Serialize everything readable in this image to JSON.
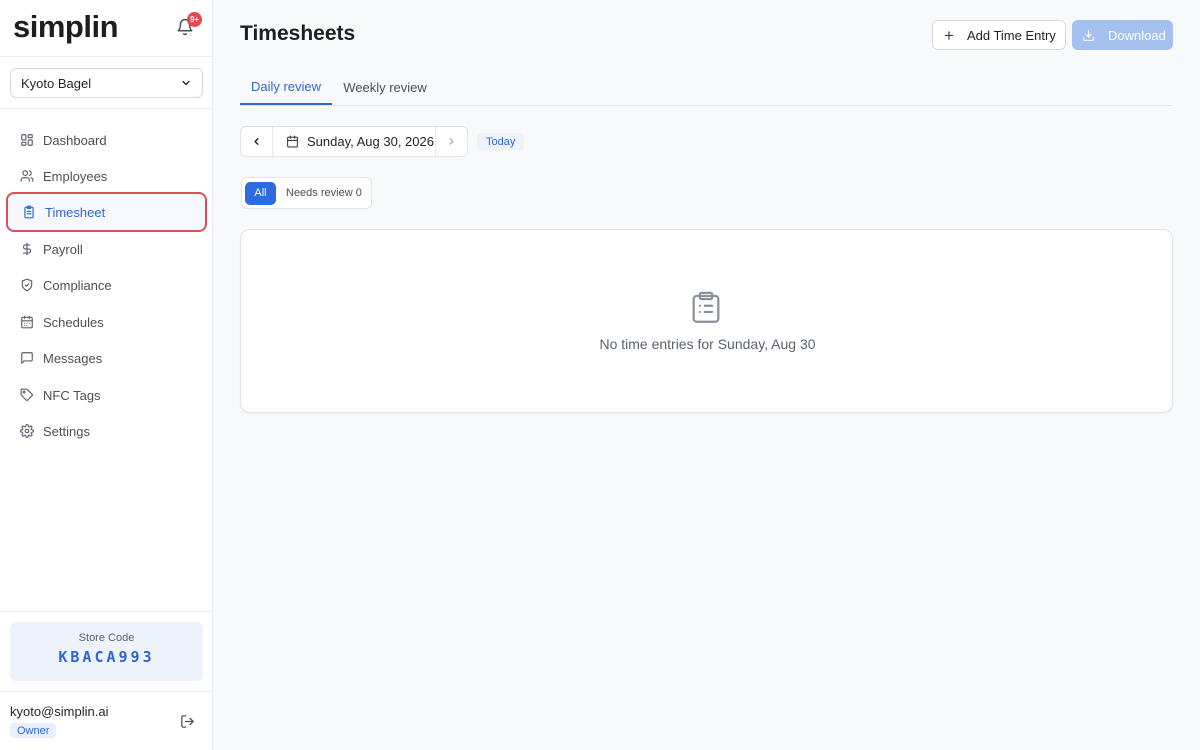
{
  "brand": {
    "name": "simplin",
    "notification_count": "9+"
  },
  "store_selector": {
    "value": "Kyoto Bagel"
  },
  "sidebar": {
    "items": [
      {
        "label": "Dashboard",
        "icon": "dashboard-icon"
      },
      {
        "label": "Employees",
        "icon": "users-icon"
      },
      {
        "label": "Timesheet",
        "icon": "clipboard-icon",
        "active": true
      },
      {
        "label": "Payroll",
        "icon": "dollar-icon"
      },
      {
        "label": "Compliance",
        "icon": "shield-icon"
      },
      {
        "label": "Schedules",
        "icon": "calendar-icon"
      },
      {
        "label": "Messages",
        "icon": "message-icon"
      },
      {
        "label": "NFC Tags",
        "icon": "tag-icon"
      },
      {
        "label": "Settings",
        "icon": "gear-icon"
      }
    ]
  },
  "store_code": {
    "label": "Store Code",
    "value": "KBACA993"
  },
  "user": {
    "email": "kyoto@simplin.ai",
    "role": "Owner"
  },
  "header": {
    "title": "Timesheets",
    "add_label": "Add Time Entry",
    "download_label": "Download"
  },
  "tabs": [
    {
      "label": "Daily review",
      "active": true
    },
    {
      "label": "Weekly review",
      "active": false
    }
  ],
  "date_nav": {
    "date": "Sunday, Aug 30, 2026",
    "today_label": "Today"
  },
  "filter": {
    "all_label": "All",
    "needs_review_label": "Needs review 0"
  },
  "empty_state": {
    "message": "No time entries for Sunday, Aug 30"
  },
  "colors": {
    "accent": "#2f66d0",
    "active_outline": "#d9505a",
    "download_disabled": "#a3c0ef",
    "badge": "#e5484d"
  }
}
